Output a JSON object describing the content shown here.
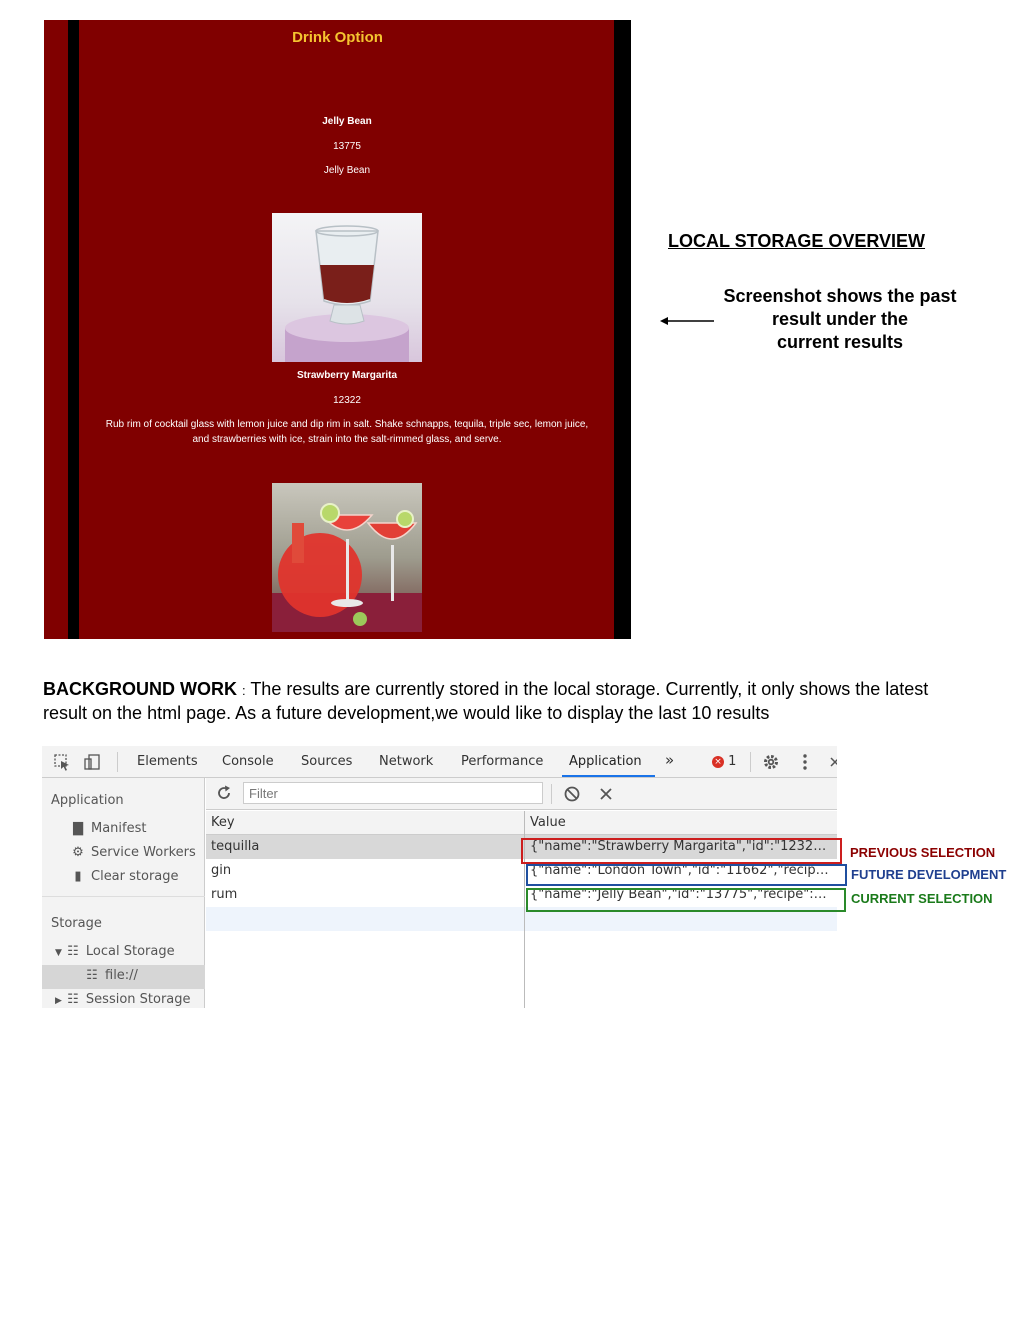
{
  "app": {
    "title": "Drink Option",
    "current": {
      "name": "Jelly Bean",
      "id": "13775",
      "recipe": "Jelly Bean"
    },
    "previous": {
      "name": "Strawberry Margarita",
      "id": "12322",
      "recipe": "Rub rim of cocktail glass with lemon juice and dip rim in salt. Shake schnapps, tequila, triple sec, lemon juice, and strawberries with ice, strain into the salt-rimmed glass, and serve."
    },
    "colors": {
      "background": "#800000",
      "title": "#f5c430"
    }
  },
  "overview": {
    "heading": "LOCAL STORAGE OVERVIEW",
    "lines": [
      "Screenshot shows the past",
      "result under the",
      "current results"
    ]
  },
  "background": {
    "label": "BACKGROUND WORK",
    "separator": ":",
    "text": "The results are currently stored in the local storage. Currently, it only shows the latest result on the html page. As a future development,we would like to display the last 10 results"
  },
  "devtools": {
    "tabs": [
      "Elements",
      "Console",
      "Sources",
      "Network",
      "Performance",
      "Application"
    ],
    "active_tab": "Application",
    "more_tabs": "»",
    "error_count": "1",
    "filter_placeholder": "Filter",
    "sidebar": {
      "application_header": "Application",
      "application_items": [
        {
          "label": "Manifest",
          "icon": "file-icon"
        },
        {
          "label": "Service Workers",
          "icon": "gear-icon"
        },
        {
          "label": "Clear storage",
          "icon": "trash-icon"
        }
      ],
      "storage_header": "Storage",
      "local_storage": "Local Storage",
      "local_storage_child": "file://",
      "session_storage": "Session Storage"
    },
    "table": {
      "headers": [
        "Key",
        "Value"
      ],
      "rows": [
        {
          "key": "tequilla",
          "value": "{\"name\":\"Strawberry Margarita\",\"id\":\"12322\",\"r…"
        },
        {
          "key": "gin",
          "value": "{\"name\":\"London Town\",\"id\":\"11662\",\"recipe\":\"l…"
        },
        {
          "key": "rum",
          "value": "{\"name\":\"Jelly Bean\",\"id\":\"13775\",\"recipe\":\"mix …"
        }
      ]
    }
  },
  "annotations": [
    {
      "label": "PREVIOUS SELECTION",
      "color": "#8b0000"
    },
    {
      "label": "FUTURE DEVELOPMENT",
      "color": "#1f3f8f"
    },
    {
      "label": "CURRENT SELECTION",
      "color": "#1a7a1a"
    }
  ]
}
